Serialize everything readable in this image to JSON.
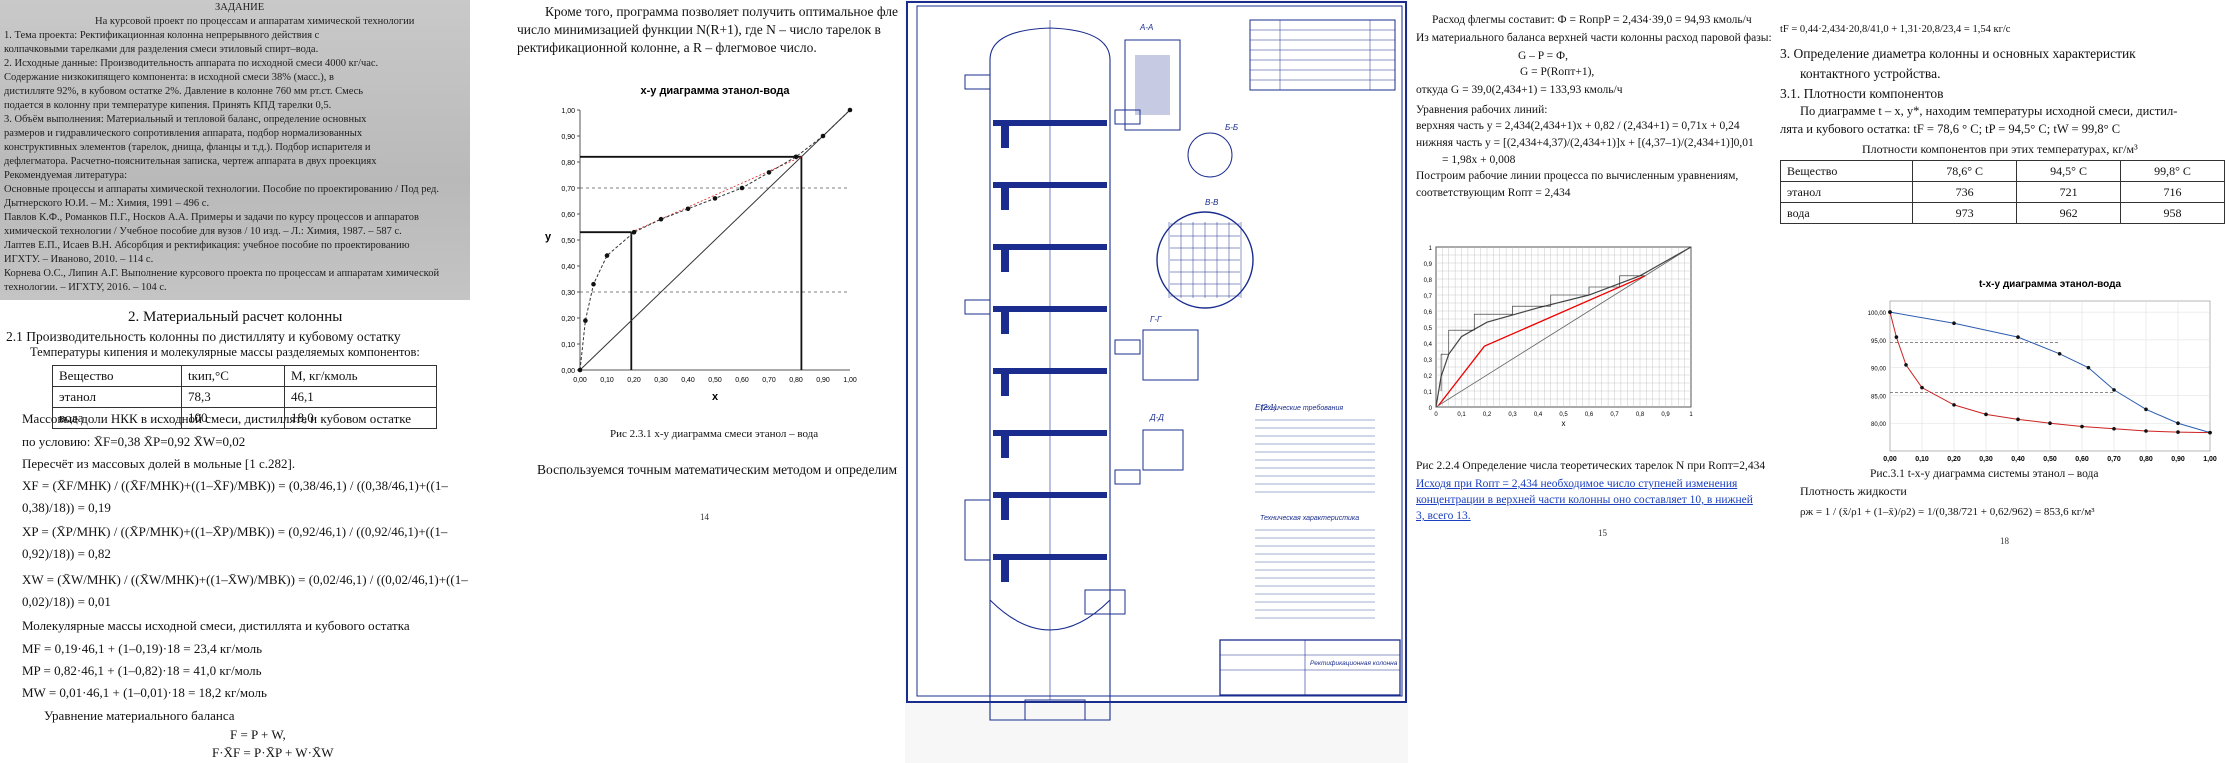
{
  "page1": {
    "scan_lines": [
      "ЗАДАНИЕ",
      "На курсовой проект по процессам и аппаратам химической технологии",
      "1. Тема проекта: Ректификационная колонна непрерывного действия с",
      "колпачковыми тарелками для разделения смеси этиловый спирт–вода.",
      "2. Исходные данные: Производительность аппарата по исходной смеси 4000 кг/час.",
      "Содержание низкокипящего компонента: в исходной смеси 38% (масс.), в",
      "дистилляте 92%, в кубовом остатке 2%. Давление в колонне 760 мм рт.ст. Смесь",
      "подается в колонну при температуре кипения. Принять КПД тарелки 0,5.",
      "3. Объём выполнения: Материальный и тепловой баланс, определение основных",
      "размеров и гидравлического сопротивления аппарата, подбор нормализованных",
      "конструктивных элементов (тарелок, днища, фланцы и т.д.). Подбор испарителя и",
      "дефлегматора. Расчетно-пояснительная записка, чертеж аппарата в двух проекциях",
      "Рекомендуемая литература:",
      "Основные процессы и аппараты химической технологии. Пособие по проектированию / Под ред.",
      "Дытнерского Ю.И. – М.: Химия, 1991 – 496 с.",
      "Павлов К.Ф., Романков П.Г., Носков А.А. Примеры и задачи по курсу процессов и аппаратов",
      "химической технологии / Учебное пособие для вузов / 10 изд. – Л.: Химия, 1987. – 587 с.",
      "Лаптев Е.П., Исаев В.Н. Абсорбция и ректификация: учебное пособие по проектированию",
      "ИГХТУ. – Иваново, 2010. – 114 с.",
      "Корнева О.С., Липин А.Г. Выполнение курсового проекта по процессам и аппаратам химической",
      "технологии. – ИГХТУ, 2016. – 104 с."
    ],
    "heading": "2.  Материальный расчет колонны",
    "subheading": "2.1 Производительность колонны по дистилляту и кубовому остатку",
    "table_intro": "Температуры кипения и молекулярные массы разделяемых компонентов:",
    "table_headers": [
      "Вещество",
      "tкип,°C",
      "M, кг/кмоль"
    ],
    "table_rows": [
      [
        "этанол",
        "78,3",
        "46,1"
      ],
      [
        "вода",
        "100",
        "18,0"
      ]
    ],
    "lines": [
      "Массовые доли НКК в исходной смеси, дистилляте и кубовом   остатке",
      "по условию:  X̄F=0,38    X̄P=0,92    X̄W=0,02",
      "Пересчёт из массовых долей в мольные  [1 с.282].",
      "XF = (X̄F/MНК) / ((X̄F/MНК)+((1–X̄F)/MВК)) = (0,38/46,1) / ((0,38/46,1)+((1–",
      "0,38)/18)) = 0,19",
      "XP = (X̄P/MНК) / ((X̄P/MНК)+((1–X̄P)/MВК)) = (0,92/46,1) / ((0,92/46,1)+((1–",
      "0,92)/18)) = 0,82",
      "XW = (X̄W/MНК) / ((X̄W/MНК)+((1–X̄W)/MВК)) = (0,02/46,1) / ((0,02/46,1)+((1–",
      "0,02)/18)) = 0,01",
      "Молекулярные массы исходной смеси, дистиллята и кубового остатка",
      "MF = 0,19·46,1 + (1–0,19)·18 = 23,4 кг/моль",
      "MP = 0,82·46,1 + (1–0,82)·18 = 41,0 кг/моль",
      "MW = 0,01·46,1 + (1–0,01)·18 = 18,2 кг/моль",
      "Уравнение материального баланса",
      "F = P + W,",
      "F·X̄F = P·X̄P + W·X̄W"
    ]
  },
  "page2": {
    "intro": [
      "Кроме того, программа позволяет получить оптимальное флегмовое",
      "число минимизацией функции N(R+1), где N – число тарелок в",
      "ректификационной колонне, а R – флегмовое число."
    ],
    "caption": "Рис 2.3.1 x-y диаграмма смеси этанол – вода",
    "closing": "Воспользуемся точным математическим методом и определим βопт.",
    "page_number": "14"
  },
  "page3": {
    "stamp_title": "Ректификационная колонна",
    "view_labels": [
      "А-А",
      "Б-Б",
      "В-В",
      "Г-Г",
      "Д-Д",
      "Е(2:1)"
    ],
    "spec_title": "Технические требования",
    "spec_title2": "Техническая характеристика"
  },
  "page4": {
    "lines": [
      "Расход флегмы составит:  Ф = RопрP = 2,434·39,0 = 94,93 кмоль/ч",
      "Из материального баланса верхней части колонны расход паровой фазы:",
      "G – P = Ф,",
      "G = P(Rопт+1),",
      "откуда G = 39,0(2,434+1) = 133,93 кмоль/ч",
      "Уравнения рабочих линий:",
      "верхняя часть y = 2,434(2,434+1)x + 0,82 / (2,434+1) = 0,71x + 0,24",
      "нижняя часть  y = [(2,434+4,37)/(2,434+1)]x + [(4,37–1)/(2,434+1)]0,01",
      "= 1,98x + 0,008",
      "Построим рабочие линии процесса по вычисленным уравнениям,",
      "соответствующим Rопт = 2,434"
    ],
    "caption": "Рис 2.2.4 Определение числа теоретических тарелок N при Rопт=2,434",
    "note": [
      "Исходя   при Rопт = 2,434 необходимое   число   ступеней   изменения",
      "концентрации в верхней части колонны оно составляет 10, в нижней",
      "3, всего 13."
    ],
    "page_number": "15"
  },
  "page5": {
    "top_line": "tF = 0,44·2,434·20,8/41,0 + 1,31·20,8/23,4 = 1,54 кг/с",
    "heading1": "3.      Определение диаметра колонны и основных характеристик",
    "heading2": "контактного устройства.",
    "sub": "3.1. Плотности компонентов",
    "lines": [
      "По диаграмме t – x, y*, находим температуры исходной смеси, дистил-",
      "лята и кубового остатка: tF = 78,6 ° С; tP = 94,5° С; tW = 99,8° С"
    ],
    "table_title": "Плотности компонентов при этих температурах, кг/м³",
    "table_rows": [
      [
        "Вещество",
        "78,6° С",
        "94,5° С",
        "99,8° С"
      ],
      [
        "этанол",
        "736",
        "721",
        "716"
      ],
      [
        "вода",
        "973",
        "962",
        "958"
      ]
    ],
    "caption": "Рис.3.1 t-x-y диаграмма системы этанол – вода",
    "sub2": "Плотность жидкости",
    "formula": "ρж = 1 / (x̄/ρ1 + (1–x̄)/ρ2) = 1/(0,38/721 + 0,62/962) = 853,6 кг/м³",
    "page_number": "18"
  },
  "chart_data": [
    {
      "type": "line",
      "title": "x-y диаграмма этанол-вода",
      "xlabel": "x",
      "ylabel": "y",
      "xlim": [
        0,
        1
      ],
      "ylim": [
        0,
        1
      ],
      "x_ticks": [
        "0,00",
        "0,10",
        "0,20",
        "0,30",
        "0,40",
        "0,50",
        "0,60",
        "0,70",
        "0,80",
        "0,90",
        "1,00"
      ],
      "y_ticks": [
        "0,00",
        "0,10",
        "0,20",
        "0,30",
        "0,40",
        "0,50",
        "0,60",
        "0,70",
        "0,80",
        "0,90",
        "1,00"
      ],
      "series": [
        {
          "values": [
            [
              0.0,
              0.0
            ],
            [
              0.02,
              0.19
            ],
            [
              0.05,
              0.33
            ],
            [
              0.1,
              0.44
            ],
            [
              0.2,
              0.53
            ],
            [
              0.3,
              0.58
            ],
            [
              0.4,
              0.62
            ],
            [
              0.5,
              0.66
            ],
            [
              0.6,
              0.7
            ],
            [
              0.7,
              0.76
            ],
            [
              0.8,
              0.82
            ],
            [
              0.9,
              0.9
            ],
            [
              1.0,
              1.0
            ]
          ]
        }
      ],
      "grid": false
    },
    {
      "type": "line",
      "xlabel": "x",
      "xlim": [
        0,
        1
      ],
      "ylim": [
        0,
        1
      ],
      "x_ticks": [
        "0",
        "0,1",
        "0,2",
        "0,3",
        "0,4",
        "0,5",
        "0,6",
        "0,7",
        "0,8",
        "0,9",
        "1"
      ],
      "y_ticks": [
        "0",
        "0,1",
        "0,2",
        "0,3",
        "0,4",
        "0,5",
        "0,6",
        "0,7",
        "0,8",
        "0,9",
        "1"
      ],
      "series": [
        {
          "values": [
            [
              0,
              0
            ],
            [
              0.02,
              0.19
            ],
            [
              0.05,
              0.33
            ],
            [
              0.1,
              0.44
            ],
            [
              0.2,
              0.53
            ],
            [
              0.4,
              0.62
            ],
            [
              0.6,
              0.7
            ],
            [
              0.8,
              0.82
            ],
            [
              1,
              1
            ]
          ]
        },
        {
          "values": [
            [
              0.01,
              0.01
            ],
            [
              0.19,
              0.38
            ],
            [
              0.82,
              0.82
            ]
          ]
        }
      ],
      "grid": true
    },
    {
      "type": "line",
      "title": "t-x-y диаграмма этанол-вода",
      "xlim": [
        0,
        1
      ],
      "ylim": [
        75,
        102
      ],
      "x_ticks": [
        "0,00",
        "0,10",
        "0,20",
        "0,30",
        "0,40",
        "0,50",
        "0,60",
        "0,70",
        "0,80",
        "0,90",
        "1,00"
      ],
      "y_ticks": [
        "80,00",
        "85,00",
        "90,00",
        "95,00",
        "100,00"
      ],
      "series": [
        {
          "values": [
            [
              0,
              100
            ],
            [
              0.02,
              95.5
            ],
            [
              0.05,
              90.5
            ],
            [
              0.1,
              86.4
            ],
            [
              0.2,
              83.3
            ],
            [
              0.3,
              81.6
            ],
            [
              0.4,
              80.7
            ],
            [
              0.5,
              80.0
            ],
            [
              0.6,
              79.4
            ],
            [
              0.7,
              79.0
            ],
            [
              0.8,
              78.6
            ],
            [
              0.9,
              78.4
            ],
            [
              1,
              78.3
            ]
          ]
        },
        {
          "values": [
            [
              0,
              100
            ],
            [
              0.2,
              98
            ],
            [
              0.4,
              95.5
            ],
            [
              0.53,
              92.5
            ],
            [
              0.62,
              90
            ],
            [
              0.7,
              86
            ],
            [
              0.8,
              82.5
            ],
            [
              0.9,
              80
            ],
            [
              1,
              78.3
            ]
          ]
        }
      ],
      "grid": true
    }
  ]
}
